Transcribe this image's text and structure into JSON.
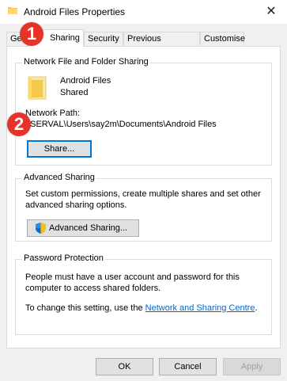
{
  "window": {
    "title": "Android Files Properties",
    "close_glyph": "✕"
  },
  "tabs": [
    {
      "label": "General",
      "visible_label": "Ge"
    },
    {
      "label": "Sharing",
      "active": true
    },
    {
      "label": "Security"
    },
    {
      "label": "Previous Versions"
    },
    {
      "label": "Customise"
    }
  ],
  "network_sharing": {
    "title": "Network File and Folder Sharing",
    "folder_name": "Android Files",
    "folder_status": "Shared",
    "path_label": "Network Path:",
    "path_value": "\\\\SERVAL\\Users\\say2m\\Documents\\Android Files",
    "share_button": "Share..."
  },
  "advanced_sharing": {
    "title": "Advanced Sharing",
    "description_line1": "Set custom permissions, create multiple shares and set other",
    "description_line2": "advanced sharing options.",
    "button": "Advanced Sharing..."
  },
  "password_protection": {
    "title": "Password Protection",
    "line1": "People must have a user account and password for this",
    "line2": "computer to access shared folders.",
    "change_prefix": "To change this setting, use the ",
    "link": "Network and Sharing Centre",
    "change_suffix": "."
  },
  "footer": {
    "ok": "OK",
    "cancel": "Cancel",
    "apply": "Apply"
  },
  "annotations": [
    {
      "number": "1"
    },
    {
      "number": "2"
    }
  ],
  "colors": {
    "badge": "#e5332a",
    "focus": "#0078d7",
    "link": "#0066cc",
    "folder": "#f5c84c"
  }
}
